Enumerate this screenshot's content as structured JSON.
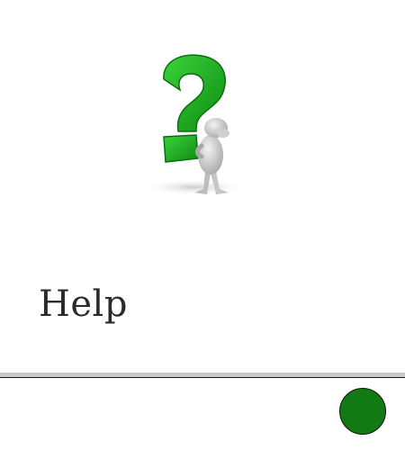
{
  "help": {
    "title": "Help",
    "illustration_icon": "question-mark-figure-icon"
  },
  "colors": {
    "question_mark": "#1fb51f",
    "question_mark_dark": "#0f8a12",
    "figure": "#d9d9d9",
    "button": "#127a12",
    "divider_light": "#c8c8c8",
    "divider_dark": "#1a1a1a",
    "text": "#2b2b2b"
  }
}
